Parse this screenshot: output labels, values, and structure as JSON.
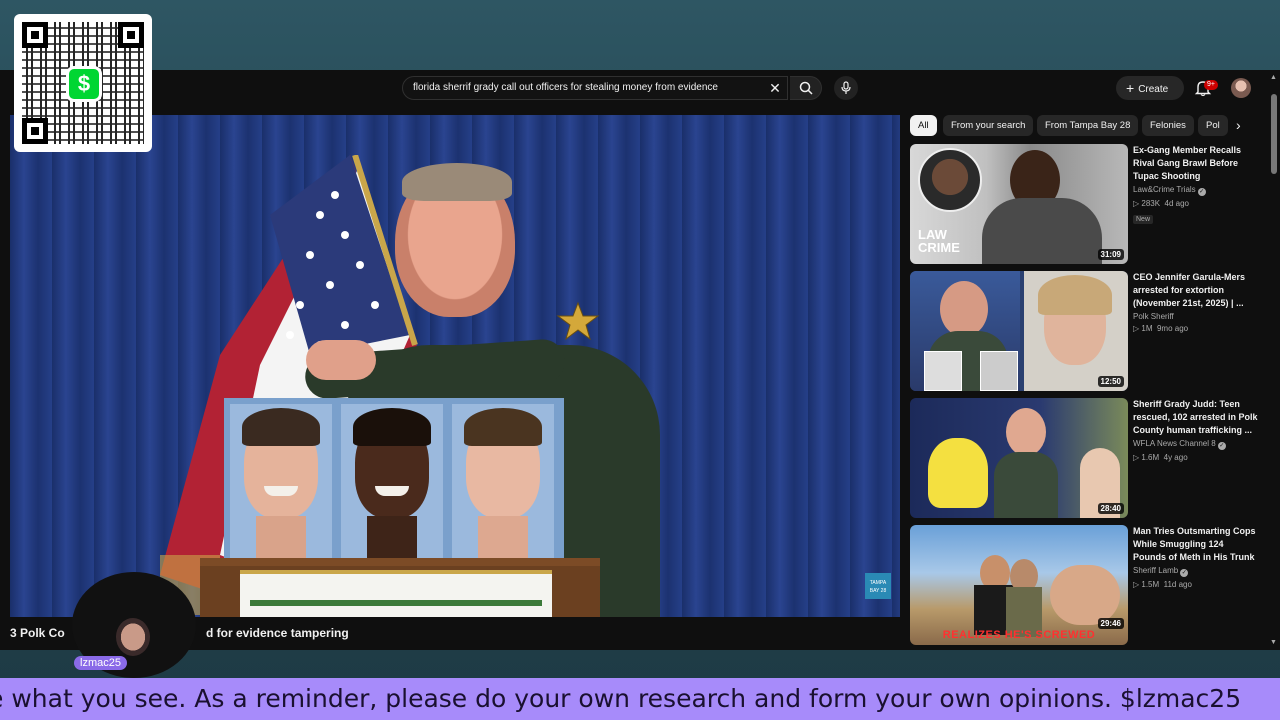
{
  "search": {
    "query": "florida sherrif grady call out officers for stealing money from evidence"
  },
  "header": {
    "create_label": "Create",
    "notification_count": "9+"
  },
  "player": {
    "channel_logo_text": "TAMPA BAY 28"
  },
  "video": {
    "title_part1": "3 Polk Co",
    "title_part2": "d for evidence tampering"
  },
  "chips": [
    {
      "label": "All"
    },
    {
      "label": "From your search"
    },
    {
      "label": "From Tampa Bay 28"
    },
    {
      "label": "Felonies"
    },
    {
      "label": "Pol"
    }
  ],
  "recommendations": [
    {
      "title": "Ex-Gang Member Recalls Rival Gang Brawl Before Tupac Shooting",
      "channel": "Law&Crime Trials",
      "views": "283K",
      "age": "4d ago",
      "badge": "New",
      "duration": "31:09",
      "thumb_text": "LAW CRIME"
    },
    {
      "title": "CEO Jennifer Garula-Mers arrested for extortion (November 21st, 2025) | ...",
      "channel": "Polk Sheriff",
      "views": "1M",
      "age": "9mo ago",
      "duration": "12:50"
    },
    {
      "title": "Sheriff Grady Judd: Teen rescued, 102 arrested in Polk County human trafficking ...",
      "channel": "WFLA News Channel 8",
      "views": "1.6M",
      "age": "4y ago",
      "duration": "28:40"
    },
    {
      "title": "Man Tries Outsmarting Cops While Smuggling 124 Pounds of Meth in His Trunk",
      "channel": "Sheriff Lamb",
      "views": "1.5M",
      "age": "11d ago",
      "duration": "29:46",
      "thumb_text": "REALIZES HE'S SCREWED"
    }
  ],
  "overlay": {
    "qr_symbol": "$",
    "streamer_name": "lzmac25",
    "ticker": "e what you see. As a reminder, please do your own research and form your own opinions. $lzmac25"
  },
  "colors": {
    "ticker_bg": "#a78bfa",
    "cashapp_green": "#00d632",
    "youtube_bg": "#0f0f0f"
  }
}
